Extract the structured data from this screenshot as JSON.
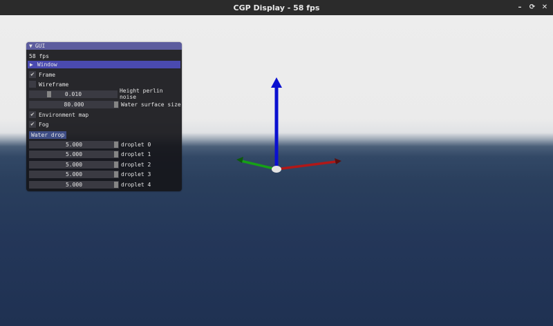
{
  "window": {
    "title": "CGP Display - 58 fps",
    "controls": [
      "–",
      "⟳",
      "✕"
    ]
  },
  "gui": {
    "title": "GUI",
    "fps_text": "58 fps",
    "window_header": "Window",
    "frame_label": "Frame",
    "frame_checked": true,
    "wireframe_label": "Wireframe",
    "wireframe_checked": false,
    "height_perlin": {
      "value": "0.010",
      "label": "Height perlin noise",
      "fraction": 0.2
    },
    "water_surface": {
      "value": "80.000",
      "label": "Water surface size",
      "fraction": 1.0
    },
    "env_map_label": "Environment map",
    "env_map_checked": true,
    "fog_label": "Fog",
    "fog_checked": true,
    "water_drop_button": "Water drop",
    "droplets": [
      {
        "value": "5.000",
        "label": "droplet 0"
      },
      {
        "value": "5.000",
        "label": "droplet 1"
      },
      {
        "value": "5.000",
        "label": "droplet 2"
      },
      {
        "value": "5.000",
        "label": "droplet 3"
      },
      {
        "value": "5.000",
        "label": "droplet 4"
      }
    ]
  },
  "axes": {
    "x_color": "#b01818",
    "y_color": "#16a016",
    "z_color": "#0a10d0"
  }
}
